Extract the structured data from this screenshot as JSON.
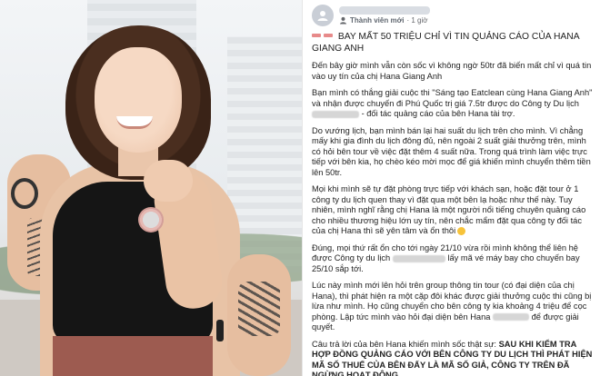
{
  "post": {
    "badge": "Thành viên mới",
    "time": "· 1 giờ",
    "title": "BAY MẤT 50 TRIỆU CHỈ VÌ TIN QUẢNG CÁO CỦA HANA GIANG ANH",
    "p1": "Đến bây giờ mình vẫn còn sốc vì không ngờ 50tr đã biến mất chỉ vì quá tin vào uy tín của chị Hana Giang Anh",
    "p2a": "Bạn mình có thắng giải cuộc thi \"Sáng tạo Eatclean cùng Hana Giang Anh\" và nhận được chuyến đi Phú Quốc trị giá 7.5tr ",
    "p2b": "được do Công ty Du lịch",
    "p2c": " - đối tác quảng cáo của bên Hana tài trợ.",
    "p3": "Do vướng lịch, bạn mình bán lại hai suất du lịch trên cho mình. Vì chẳng mấy khi gia đình du lịch đông đủ, nên ngoài 2 suất giải thưởng trên, mình có hỏi bên tour về việc đặt thêm 4 suất nữa. Trong quá trình làm việc trực tiếp với bên kia, họ chèo kéo mời mọc để giá khiến mình chuyển thêm tiền lên 50tr.",
    "p4a": "Mọi khi mình sẽ tự đặt phòng trực tiếp với khách sạn, hoặc đặt tour ở 1 công ty du lịch quen thay vì đặt qua một bên lạ hoặc như thế này. Tuy nhiên, mình nghĩ rằng chị Hana là một người nổi tiếng chuyên quảng cáo cho nhiều thương hiệu lớn uy tín, nên chắc mẩm đặt qua công ty đối tác của chị Hana thì sẽ yên tâm và ổn thôi",
    "p5a": "Đúng, mọi thứ rất ổn cho tới ngày 21/10 vừa rồi mình không thể liên hệ được Công ty du lịch ",
    "p5b": " lấy mã vé máy bay cho chuyến bay 25/10 sắp tới.",
    "p6a": "Lúc này mình mới lên hỏi trên group thông tin tour (có đại diện của chị Hana), thì phát hiện ra một cặp đôi khác được giải thưởng cuộc thi cũng bị lừa như mình. Họ cũng chuyển cho bên công ty kia khoảng 4 triệu để cọc phòng. Lập tức mình vào hỏi đại diện bên Hana",
    "p6b": " để được giải quyết.",
    "p7a": "Câu trả lời của bên Hana khiến mình sốc thật sự: ",
    "p7b": "SAU KHI KIỂM TRA HỢP ĐỒNG QUẢNG CÁO VỚI BÊN CÔNG TY DU LỊCH THÌ PHÁT HIỆN MÃ SỐ THUẾ CỦA BÊN ĐẤY LÀ MÃ SỐ GIẢ, CÔNG TY TRÊN ĐÃ NGỪNG HOẠT ĐỘNG."
  },
  "colors": {
    "accent_dash": "#e78a8a",
    "text": "#222222",
    "muted": "#65676b"
  }
}
